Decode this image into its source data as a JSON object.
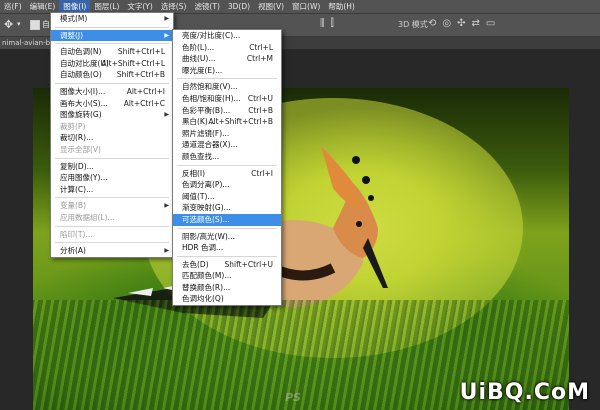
{
  "menubar": {
    "items": [
      "巡(F)",
      "编辑(E)",
      "图像(I)",
      "图层(L)",
      "文字(Y)",
      "选择(S)",
      "滤镜(T)",
      "3D(D)",
      "视图(V)",
      "窗口(W)",
      "帮助(H)"
    ],
    "active_index": 2
  },
  "options": {
    "auto_label": "自动",
    "three_d_mode": "3D 模式"
  },
  "tab": {
    "label": "nimal-avian-bird"
  },
  "menu_image": {
    "rows": [
      {
        "label": "模式(M)",
        "shortcut": "",
        "arrow": true,
        "disabled": false
      },
      {
        "sep": true
      },
      {
        "label": "调整(J)",
        "shortcut": "",
        "arrow": true,
        "disabled": false,
        "highlight": true
      },
      {
        "sep": true
      },
      {
        "label": "自动色调(N)",
        "shortcut": "Shift+Ctrl+L",
        "disabled": false
      },
      {
        "label": "自动对比度(U)",
        "shortcut": "Alt+Shift+Ctrl+L",
        "disabled": false
      },
      {
        "label": "自动颜色(O)",
        "shortcut": "Shift+Ctrl+B",
        "disabled": false
      },
      {
        "sep": true
      },
      {
        "label": "图像大小(I)...",
        "shortcut": "Alt+Ctrl+I",
        "disabled": false
      },
      {
        "label": "画布大小(S)...",
        "shortcut": "Alt+Ctrl+C",
        "disabled": false
      },
      {
        "label": "图像旋转(G)",
        "shortcut": "",
        "arrow": true,
        "disabled": false
      },
      {
        "label": "裁剪(P)",
        "shortcut": "",
        "disabled": true
      },
      {
        "label": "裁切(R)...",
        "shortcut": "",
        "disabled": false
      },
      {
        "label": "显示全部(V)",
        "shortcut": "",
        "disabled": true
      },
      {
        "sep": true
      },
      {
        "label": "复制(D)...",
        "shortcut": "",
        "disabled": false
      },
      {
        "label": "应用图像(Y)...",
        "shortcut": "",
        "disabled": false
      },
      {
        "label": "计算(C)...",
        "shortcut": "",
        "disabled": false
      },
      {
        "sep": true
      },
      {
        "label": "变量(B)",
        "shortcut": "",
        "arrow": true,
        "disabled": true
      },
      {
        "label": "应用数据组(L)...",
        "shortcut": "",
        "disabled": true
      },
      {
        "sep": true
      },
      {
        "label": "陷印(T)...",
        "shortcut": "",
        "disabled": true
      },
      {
        "sep": true
      },
      {
        "label": "分析(A)",
        "shortcut": "",
        "arrow": true,
        "disabled": false
      }
    ]
  },
  "menu_adjust": {
    "rows": [
      {
        "label": "亮度/对比度(C)...",
        "shortcut": ""
      },
      {
        "label": "色阶(L)...",
        "shortcut": "Ctrl+L"
      },
      {
        "label": "曲线(U)...",
        "shortcut": "Ctrl+M"
      },
      {
        "label": "曝光度(E)...",
        "shortcut": ""
      },
      {
        "sep": true
      },
      {
        "label": "自然饱和度(V)...",
        "shortcut": ""
      },
      {
        "label": "色相/饱和度(H)...",
        "shortcut": "Ctrl+U"
      },
      {
        "label": "色彩平衡(B)...",
        "shortcut": "Ctrl+B"
      },
      {
        "label": "黑白(K)...",
        "shortcut": "Alt+Shift+Ctrl+B"
      },
      {
        "label": "照片滤镜(F)...",
        "shortcut": ""
      },
      {
        "label": "通道混合器(X)...",
        "shortcut": ""
      },
      {
        "label": "颜色查找...",
        "shortcut": ""
      },
      {
        "sep": true
      },
      {
        "label": "反相(I)",
        "shortcut": "Ctrl+I"
      },
      {
        "label": "色调分离(P)...",
        "shortcut": ""
      },
      {
        "label": "阈值(T)...",
        "shortcut": ""
      },
      {
        "label": "渐变映射(G)...",
        "shortcut": ""
      },
      {
        "label": "可选颜色(S)...",
        "shortcut": "",
        "highlight": true
      },
      {
        "sep": true
      },
      {
        "label": "阴影/高光(W)...",
        "shortcut": ""
      },
      {
        "label": "HDR 色调...",
        "shortcut": ""
      },
      {
        "sep": true
      },
      {
        "label": "去色(D)",
        "shortcut": "Shift+Ctrl+U"
      },
      {
        "label": "匹配颜色(M)...",
        "shortcut": ""
      },
      {
        "label": "替换颜色(R)...",
        "shortcut": ""
      },
      {
        "label": "色调均化(Q)",
        "shortcut": ""
      }
    ]
  },
  "watermark": {
    "ps": "PS",
    "brand": "UiBQ.CoM"
  }
}
